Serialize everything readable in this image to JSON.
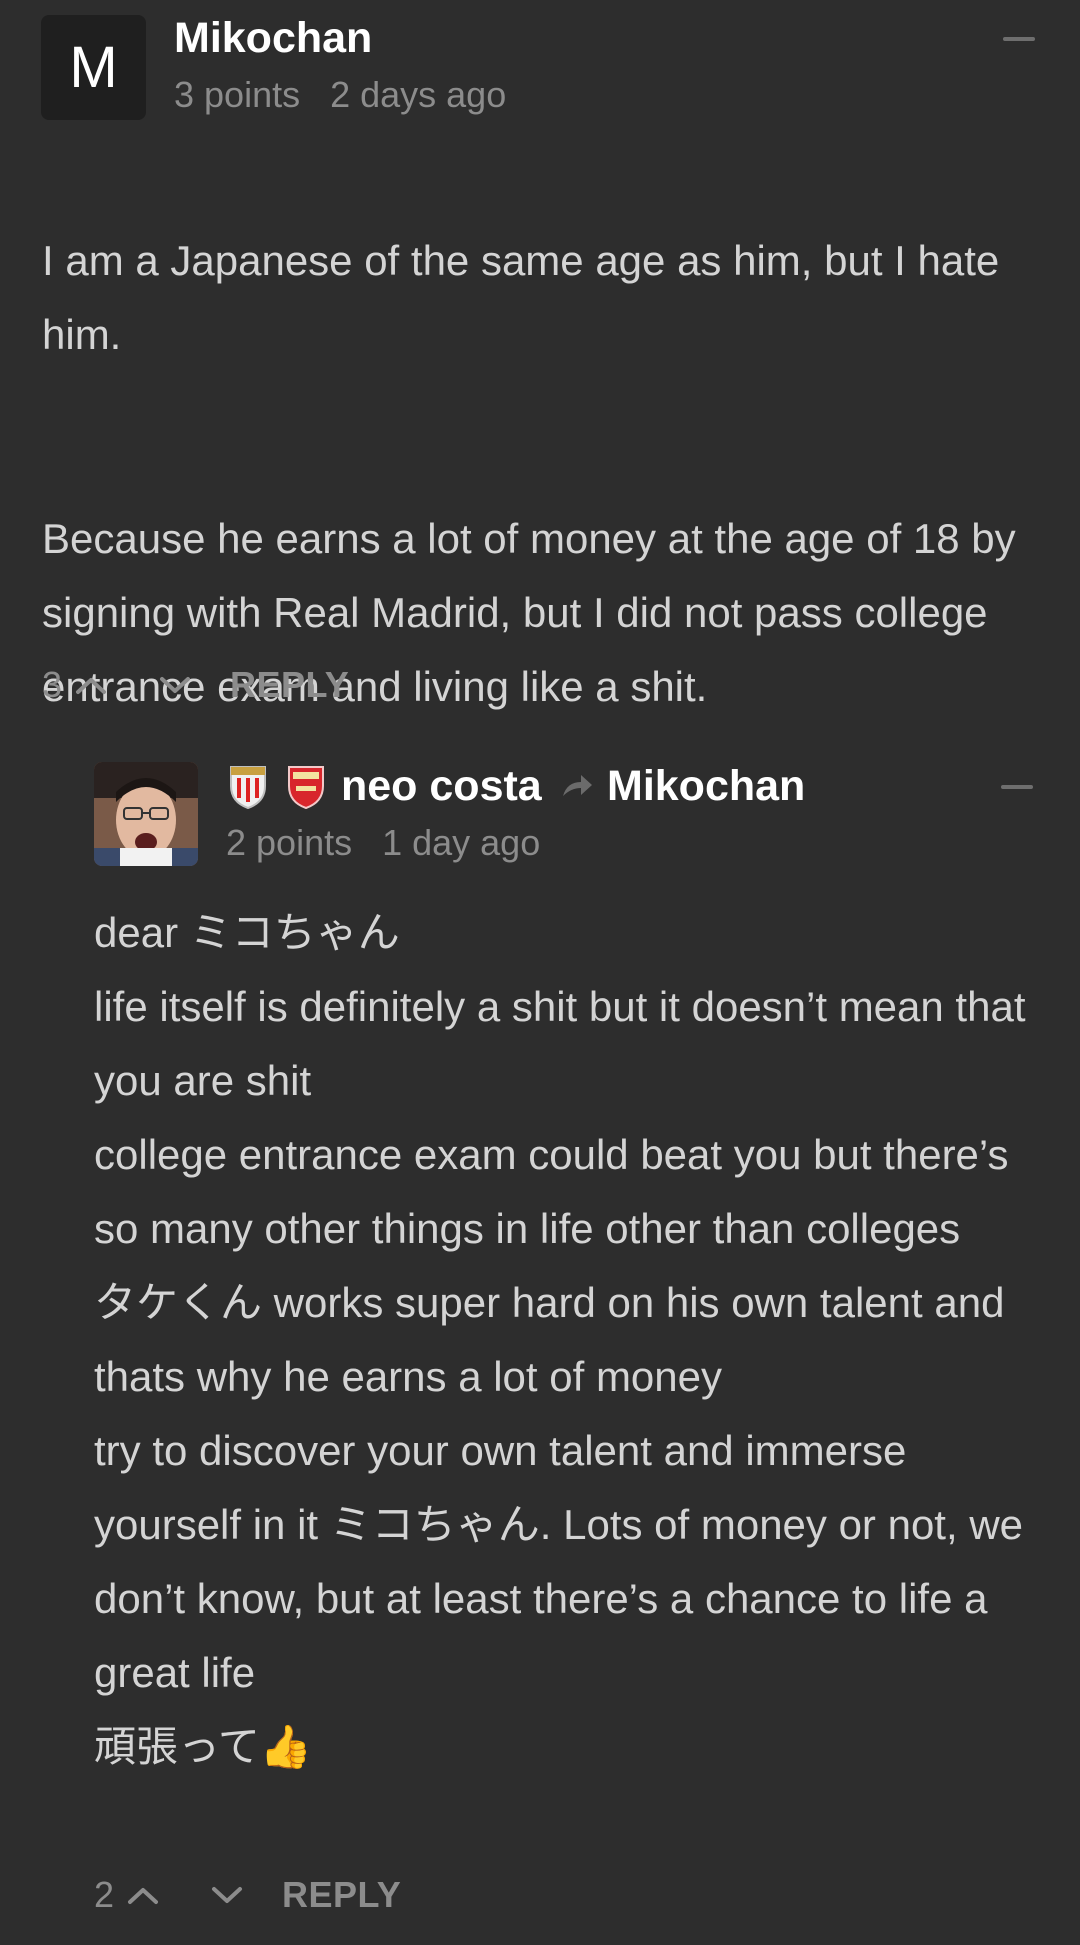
{
  "comments": [
    {
      "avatar_letter": "M",
      "author": "Mikochan",
      "points": "3 points",
      "time": "2 days ago",
      "paragraphs": [
        "I am a Japanese of the same age as him, but I hate him.",
        "Because he earns a lot of money at the age of 18 by signing with Real Madrid, but I did not pass college entrance exam and living like a shit."
      ],
      "score": "3",
      "reply_label": "REPLY"
    },
    {
      "author": "neo costa",
      "reply_to": "Mikochan",
      "points": "2 points",
      "time": "1 day ago",
      "body": "dear ミコちゃん\nlife itself is definitely a shit but it doesn’t mean that you are shit\ncollege entrance exam could beat you but there’s so many other things in life other than colleges\nタケくん works super hard on his own talent and thats why he earns a lot of money\ntry to discover your own talent and immerse yourself in it ミコちゃん. Lots of money or not, we don’t know, but at least there’s a chance to life a great life\n頑張って👍",
      "score": "2",
      "reply_label": "REPLY",
      "badges": [
        "athletic-club-crest",
        "arsenal-crest"
      ]
    }
  ],
  "colors": {
    "background": "#2d2d2d",
    "text": "#d4d4d4",
    "muted": "#8c8c8c",
    "author": "#ffffff"
  }
}
